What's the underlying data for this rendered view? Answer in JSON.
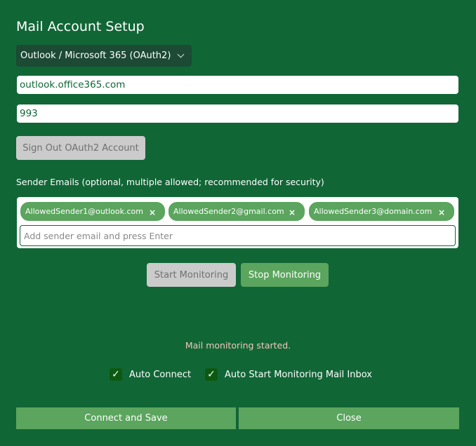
{
  "title": "Mail Account Setup",
  "provider": {
    "selected": "Outlook / Microsoft 365 (OAuth2)"
  },
  "server": {
    "value": "outlook.office365.com"
  },
  "port": {
    "value": "993"
  },
  "sign_out_label": "Sign Out OAuth2 Account",
  "sender_label": "Sender Emails (optional, multiple allowed; recommended for security)",
  "senders": [
    "AllowedSender1@outlook.com",
    "AllowedSender2@gmail.com",
    "AllowedSender3@domain.com"
  ],
  "remove_glyph": "×",
  "add_sender_placeholder": "Add sender email and press Enter",
  "start_label": "Start Monitoring",
  "stop_label": "Stop Monitoring",
  "status": "Mail monitoring started.",
  "checkboxes": [
    {
      "label": "Auto Connect",
      "checked": true
    },
    {
      "label": "Auto Start Monitoring Mail Inbox",
      "checked": true
    }
  ],
  "check_glyph": "✓",
  "connect_label": "Connect and Save",
  "close_label": "Close"
}
